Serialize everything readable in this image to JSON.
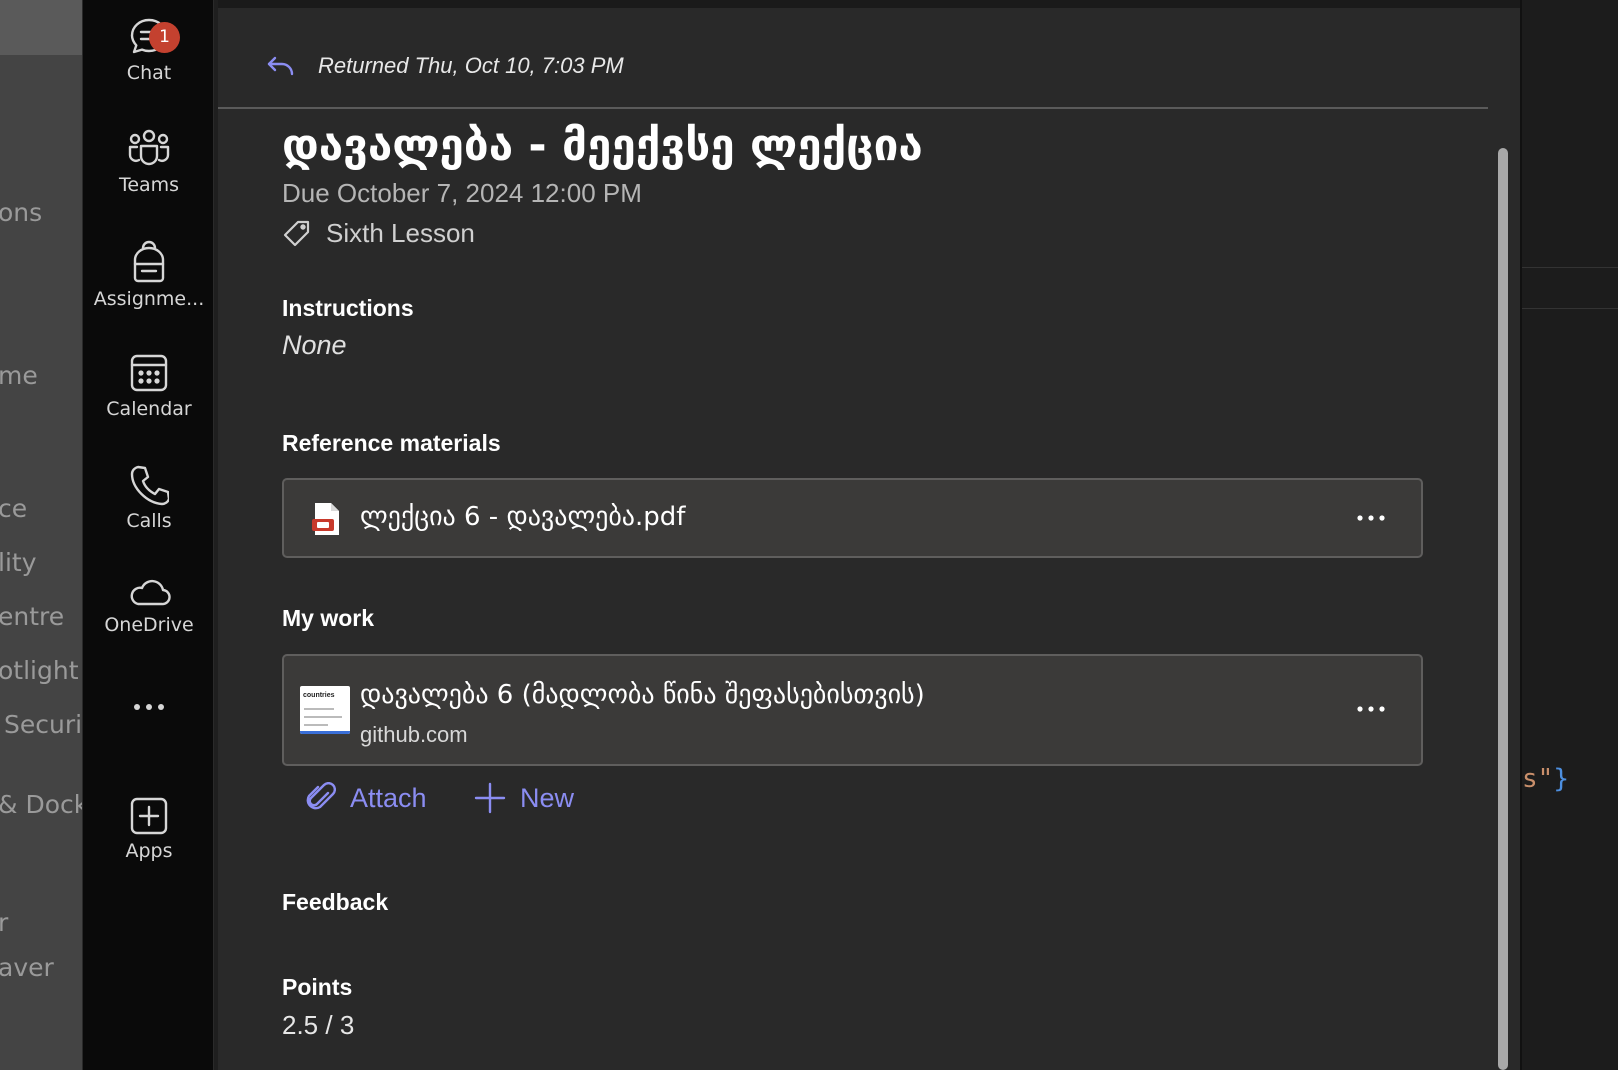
{
  "background_left": {
    "fragments": [
      "ons",
      "me",
      "ce",
      "lity",
      "entre",
      "otlight",
      "Securi",
      "& Dock",
      "r",
      "aver"
    ]
  },
  "rail": {
    "items": [
      {
        "id": "chat",
        "label": "Chat",
        "icon": "chat-icon",
        "badge": "1"
      },
      {
        "id": "teams",
        "label": "Teams",
        "icon": "teams-icon"
      },
      {
        "id": "assignments",
        "label": "Assignme...",
        "icon": "backpack-icon"
      },
      {
        "id": "calendar",
        "label": "Calendar",
        "icon": "calendar-icon"
      },
      {
        "id": "calls",
        "label": "Calls",
        "icon": "phone-icon"
      },
      {
        "id": "onedrive",
        "label": "OneDrive",
        "icon": "cloud-icon"
      },
      {
        "id": "more",
        "label": "",
        "icon": "more-horizontal-icon"
      },
      {
        "id": "apps",
        "label": "Apps",
        "icon": "add-app-icon"
      }
    ]
  },
  "assignment": {
    "returned": "Returned Thu, Oct 10, 7:03 PM",
    "title": "დავალება - მეექვსე ლექცია",
    "due": "Due October 7, 2024 12:00 PM",
    "tag": "Sixth Lesson",
    "instructions_heading": "Instructions",
    "instructions_value": "None",
    "reference_heading": "Reference materials",
    "reference_file": {
      "name": "ლექცია 6 - დავალება.pdf",
      "icon": "pdf-file-icon"
    },
    "my_work_heading": "My work",
    "my_work_item": {
      "name": "დავალება 6 (მადლობა წინა შეფასებისთვის)",
      "source": "github.com",
      "thumb_text": "countries"
    },
    "attach_label": "Attach",
    "new_label": "New",
    "feedback_heading": "Feedback",
    "points_heading": "Points",
    "points_value": "2.5 / 3"
  },
  "background_right": {
    "code_fragment": "s\"",
    "code_brace": "}"
  },
  "colors": {
    "accent": "#8b8df2",
    "badge": "#c4412f",
    "panel_bg": "#292929",
    "card_bg": "#3b3a39"
  }
}
